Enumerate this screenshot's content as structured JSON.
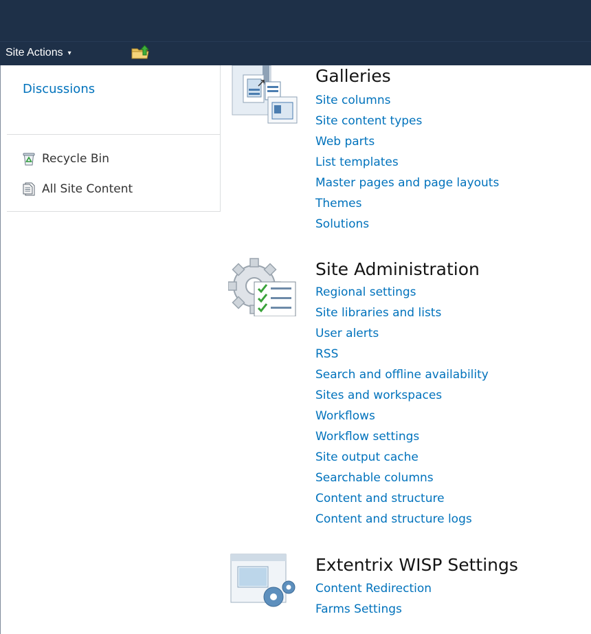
{
  "ribbon": {
    "site_actions_label": "Site Actions",
    "site_actions_caret": "▾",
    "navigate_up_icon": "folder-up-icon"
  },
  "left_nav": {
    "heading": "Discussions",
    "links": [
      {
        "label": "Recycle Bin",
        "icon": "recycle-bin-icon"
      },
      {
        "label": "All Site Content",
        "icon": "document-icon"
      }
    ]
  },
  "sections": [
    {
      "title": "Galleries",
      "icon": "galleries-icon",
      "links": [
        "Site columns",
        "Site content types",
        "Web parts",
        "List templates",
        "Master pages and page layouts",
        "Themes",
        "Solutions"
      ]
    },
    {
      "title": "Site Administration",
      "icon": "site-administration-icon",
      "links": [
        "Regional settings",
        "Site libraries and lists",
        "User alerts",
        "RSS",
        "Search and offline availability",
        "Sites and workspaces",
        "Workflows",
        "Workflow settings",
        "Site output cache",
        "Searchable columns",
        "Content and structure",
        "Content and structure logs"
      ]
    },
    {
      "title": "Extentrix WISP Settings",
      "icon": "wisp-settings-icon",
      "links": [
        "Content Redirection",
        "Farms Settings"
      ]
    }
  ],
  "colors": {
    "ribbon_background": "#1e3048",
    "link": "#0072bc",
    "section_title": "#141414",
    "nav_text": "#333333"
  }
}
